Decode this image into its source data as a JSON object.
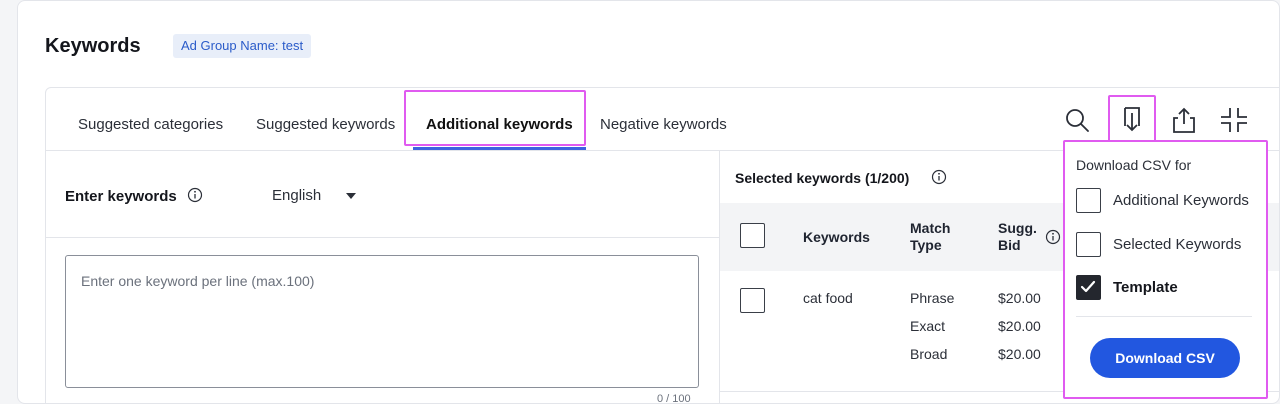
{
  "page": {
    "title": "Keywords",
    "ad_group_badge": "Ad Group Name: test"
  },
  "tabs": [
    {
      "label": "Suggested categories"
    },
    {
      "label": "Suggested keywords"
    },
    {
      "label": "Additional keywords",
      "active": true
    },
    {
      "label": "Negative keywords"
    }
  ],
  "toolbar": {
    "icons": [
      "search-icon",
      "download-icon",
      "share-icon",
      "collapse-icon"
    ]
  },
  "enter_keywords": {
    "label": "Enter keywords",
    "language": "English",
    "placeholder": "Enter one keyword per line (max.100)",
    "counter": "0 / 100"
  },
  "selected": {
    "label": "Selected keywords (1/200)",
    "columns": {
      "keywords": "Keywords",
      "match_type": "Match Type",
      "sugg_bid": "Sugg. Bid"
    },
    "rows": [
      {
        "keyword": "cat food",
        "matches": [
          {
            "type": "Phrase",
            "bid": "$20.00"
          },
          {
            "type": "Exact",
            "bid": "$20.00"
          },
          {
            "type": "Broad",
            "bid": "$20.00"
          }
        ]
      }
    ]
  },
  "download_menu": {
    "heading": "Download CSV for",
    "options": [
      {
        "label": "Additional Keywords",
        "checked": false
      },
      {
        "label": "Selected Keywords",
        "checked": false
      },
      {
        "label": "Template",
        "checked": true
      }
    ],
    "button": "Download CSV"
  },
  "colors": {
    "accent": "#2257e0",
    "tab_underline": "#3d63e0",
    "highlight": "#e05bf0"
  }
}
